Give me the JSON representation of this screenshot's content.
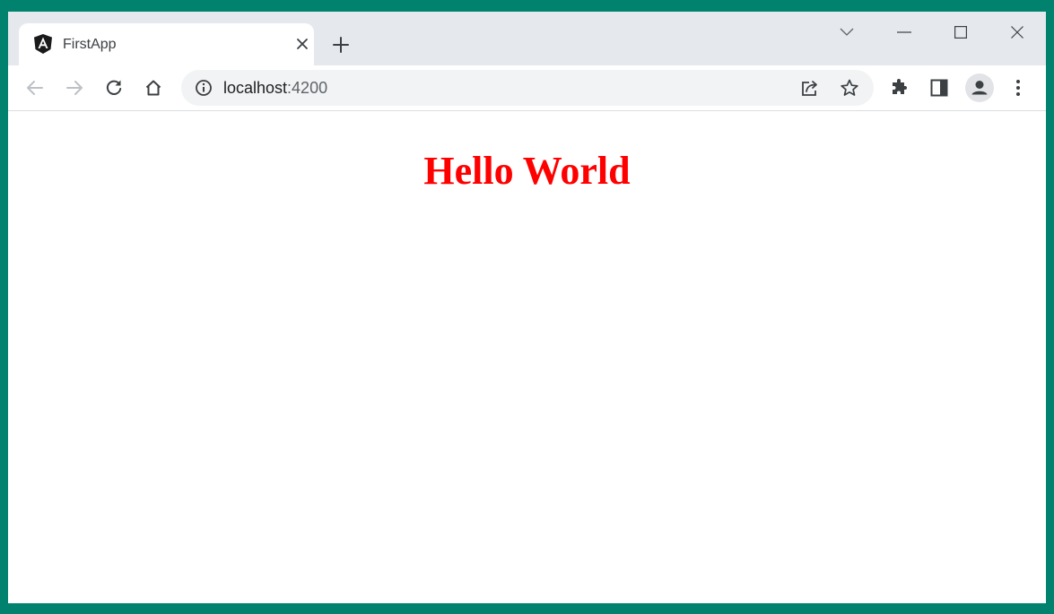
{
  "browser": {
    "tab": {
      "title": "FirstApp",
      "favicon": "angular-logo"
    },
    "address": {
      "host": "localhost",
      "port": ":4200"
    },
    "toolbar_icons": [
      "back-icon",
      "forward-icon",
      "reload-icon",
      "home-icon",
      "site-info-icon",
      "share-icon",
      "bookmark-star-icon",
      "extensions-icon",
      "side-panel-icon",
      "profile-avatar",
      "menu-icon"
    ],
    "window_controls": [
      "tab-search-icon",
      "minimize-icon",
      "maximize-icon",
      "close-window-icon"
    ]
  },
  "page": {
    "heading": "Hello World",
    "heading_color": "#ff0000"
  },
  "colors": {
    "desktop_bg": "#00826f",
    "tabstrip_bg": "#e5e8ec",
    "omnibox_bg": "#f1f3f4"
  }
}
